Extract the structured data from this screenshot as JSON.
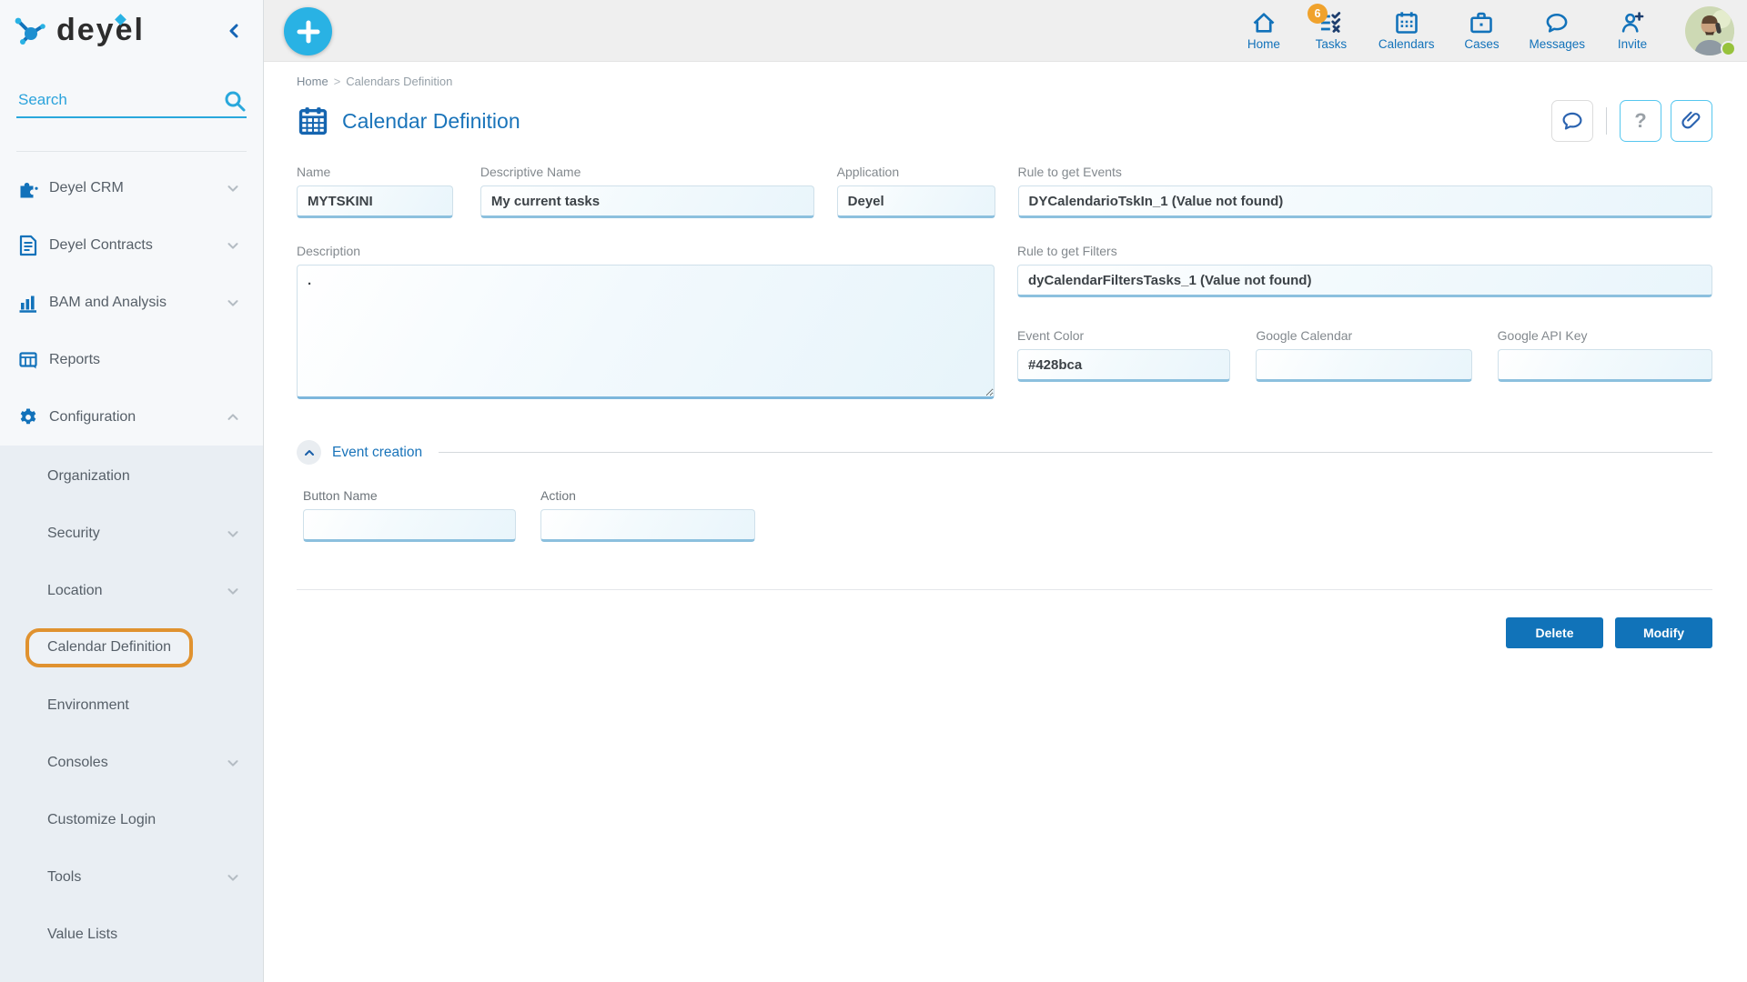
{
  "brand": {
    "logo_text": "deyel"
  },
  "sidebar": {
    "search_placeholder": "Search",
    "menu": [
      {
        "label": "Deyel CRM",
        "icon": "puzzle-icon",
        "chevron": "down"
      },
      {
        "label": "Deyel Contracts",
        "icon": "document-icon",
        "chevron": "down"
      },
      {
        "label": "BAM and Analysis",
        "icon": "bar-chart-icon",
        "chevron": "down"
      },
      {
        "label": "Reports",
        "icon": "report-icon",
        "chevron": "none"
      },
      {
        "label": "Configuration",
        "icon": "gear-icon",
        "chevron": "up"
      }
    ],
    "submenu": [
      {
        "label": "Organization",
        "chevron": "none",
        "selected": false
      },
      {
        "label": "Security",
        "chevron": "down",
        "selected": false
      },
      {
        "label": "Location",
        "chevron": "down",
        "selected": false
      },
      {
        "label": "Calendar Definition",
        "chevron": "none",
        "selected": true
      },
      {
        "label": "Environment",
        "chevron": "none",
        "selected": false
      },
      {
        "label": "Consoles",
        "chevron": "down",
        "selected": false
      },
      {
        "label": "Customize Login",
        "chevron": "none",
        "selected": false
      },
      {
        "label": "Tools",
        "chevron": "down",
        "selected": false
      },
      {
        "label": "Value Lists",
        "chevron": "none",
        "selected": false
      }
    ]
  },
  "topbar": {
    "nav": [
      {
        "label": "Home",
        "icon": "home-icon"
      },
      {
        "label": "Tasks",
        "icon": "tasks-icon",
        "badge": "6"
      },
      {
        "label": "Calendars",
        "icon": "calendar-icon"
      },
      {
        "label": "Cases",
        "icon": "briefcase-icon"
      },
      {
        "label": "Messages",
        "icon": "message-bubble-icon"
      },
      {
        "label": "Invite",
        "icon": "invite-person-icon"
      }
    ],
    "tasks_badge": "6",
    "user_status": "online"
  },
  "breadcrumb": {
    "home": "Home",
    "separator": ">",
    "current": "Calendars Definition"
  },
  "page": {
    "title": "Calendar Definition",
    "help_glyph": "?"
  },
  "form": {
    "name": {
      "label": "Name",
      "value": "MYTSKINI"
    },
    "descriptive_name": {
      "label": "Descriptive Name",
      "value": "My current tasks"
    },
    "application": {
      "label": "Application",
      "value": "Deyel"
    },
    "rule_events": {
      "label": "Rule to get Events",
      "value": "DYCalendarioTskIn_1 (Value not found)"
    },
    "description": {
      "label": "Description",
      "value": "."
    },
    "rule_filters": {
      "label": "Rule to get Filters",
      "value": "dyCalendarFiltersTasks_1 (Value not found)"
    },
    "event_color": {
      "label": "Event Color",
      "value": "#428bca"
    },
    "google_calendar": {
      "label": "Google Calendar",
      "value": ""
    },
    "google_api_key": {
      "label": "Google API Key",
      "value": ""
    }
  },
  "event_creation": {
    "title": "Event creation",
    "button_name": {
      "label": "Button Name",
      "value": ""
    },
    "action": {
      "label": "Action",
      "value": ""
    }
  },
  "buttons": {
    "delete": "Delete",
    "modify": "Modify"
  },
  "colors": {
    "accent_cyan": "#29b2e4",
    "primary_blue": "#1272ba",
    "button_blue": "#1173b9",
    "badge_orange": "#f0a22c",
    "highlight_orange": "#e0922f",
    "status_green": "#97c23c",
    "input_bottom_border": "#8cc0de"
  }
}
